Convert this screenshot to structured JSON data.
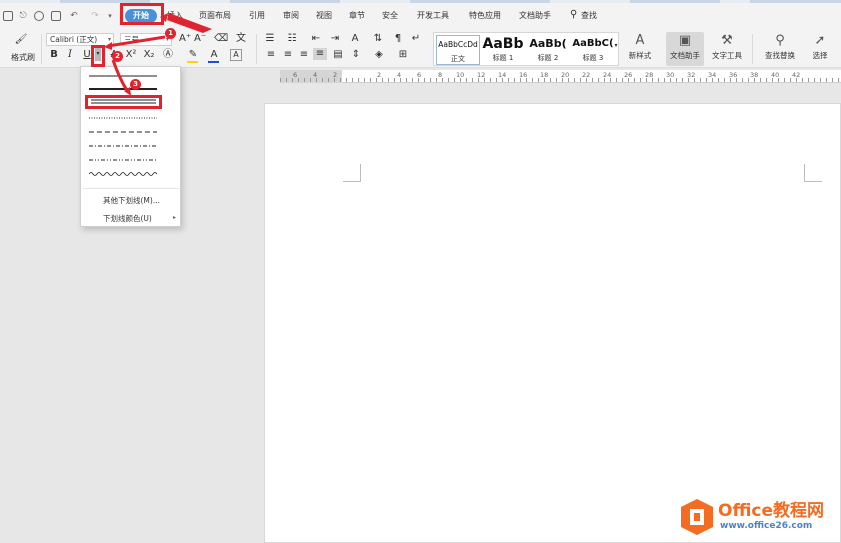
{
  "menu": {
    "tabs": [
      "开始",
      "插入",
      "页面布局",
      "引用",
      "审阅",
      "视图",
      "章节",
      "安全",
      "开发工具",
      "特色应用",
      "文档助手"
    ],
    "search_label": "查找"
  },
  "ribbon": {
    "format_painter_label": "格式刷",
    "font_name": "Calibri (正文)",
    "font_size": "三号",
    "bold": "B",
    "italic": "I",
    "underline": "U",
    "styles": [
      {
        "sample": "AaBbCcDd",
        "name": "正文"
      },
      {
        "sample": "AaBb",
        "name": "标题 1"
      },
      {
        "sample": "AaBb(",
        "name": "标题 2"
      },
      {
        "sample": "AaBbC(",
        "name": "标题 3"
      }
    ],
    "new_style_label": "新样式",
    "doc_assistant_label": "文档助手",
    "text_tools_label": "文字工具",
    "find_replace_label": "查找替换",
    "select_label": "选择"
  },
  "ruler": {
    "numbers": [
      "6",
      "4",
      "2",
      "2",
      "4",
      "6",
      "8",
      "10",
      "12",
      "14",
      "16",
      "18",
      "20",
      "22",
      "24",
      "26",
      "28",
      "30",
      "32",
      "34",
      "36",
      "38",
      "40",
      "42"
    ]
  },
  "underline_menu": {
    "more_label": "其他下划线(M)...",
    "color_label": "下划线颜色(U)"
  },
  "annotations": {
    "badges": [
      "1",
      "2",
      "3"
    ]
  },
  "watermark": {
    "brand": "Office教程网",
    "url": "www.office26.com"
  },
  "colors": {
    "accent": "#4a90d9",
    "highlight": "#e0242f",
    "brand_orange": "#f36c21",
    "font_color": "#1f4fd8"
  }
}
